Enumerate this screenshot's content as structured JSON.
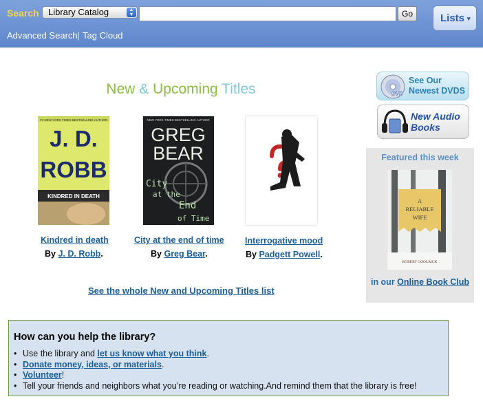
{
  "header": {
    "search_label": "Search",
    "catalog_select": "Library Catalog",
    "search_value": "",
    "go_label": "Go",
    "advanced_search": "Advanced Search",
    "separator": "|",
    "tag_cloud": "Tag Cloud",
    "lists_label": "Lists",
    "lists_caret": "▾"
  },
  "main": {
    "heading": {
      "part1": "New",
      "part2": "&",
      "part3": "Upcoming",
      "part4": "Titles"
    },
    "books": [
      {
        "title": "Kindred in death",
        "by": "By",
        "author": "J. D. Robb",
        "end": ".",
        "cover": {
          "tagline": "#1 NEW YORK TIMES BESTSELLING AUTHOR",
          "line1": "J. D.",
          "line2": "ROBB",
          "subtitle": "KINDRED IN DEATH"
        }
      },
      {
        "title": "City at the end of time",
        "by": "By",
        "author": "Greg Bear",
        "end": ".",
        "cover": {
          "tagline": "NEW YORK TIMES BESTSELLING AUTHOR",
          "line1": "GREG",
          "line2": "BEAR",
          "subtitle1": "City",
          "subtitle2": "at the",
          "subtitle3": "End",
          "subtitle4": "of Time"
        }
      },
      {
        "title": "Interrogative mood",
        "by": "By",
        "author": "Padgett Powell",
        "end": ".",
        "cover": {}
      }
    ],
    "see_whole_list": "See the whole New and Upcoming Titles list"
  },
  "sidebar": {
    "dvd_line1": "See Our",
    "dvd_line2": "Newest DVDS",
    "dvd_disc_text": "DVD",
    "audio_line1": "New Audio",
    "audio_line2": "Books",
    "featured_title": "Featured this week",
    "featured_cover": {
      "line1": "A",
      "line2": "RELIABLE",
      "line3": "WIFE",
      "author": "ROBERT GOOLRICK"
    },
    "featured_prefix": "in our",
    "featured_link": "Online Book Club"
  },
  "help": {
    "title": "How can you help the library?",
    "item1_prefix": "Use the library and",
    "item1_link": "let us know what you think",
    "item1_suffix": ".",
    "item2_link": "Donate money, ideas, or materials",
    "item2_suffix": ".",
    "item3_link": "Volunteer",
    "item3_suffix": "!",
    "item4": "Tell your friends and neighbors what you’re reading or watching.And remind them that the library is free!"
  },
  "colors": {
    "header_bar": "#6f95d6",
    "search_label": "#f3d54e",
    "link": "#1a5e9a",
    "heading_green": "#8cbf3f",
    "heading_teal": "#7fc9d8",
    "help_bg": "#d7e2f0",
    "help_border": "#6a9a3a"
  }
}
